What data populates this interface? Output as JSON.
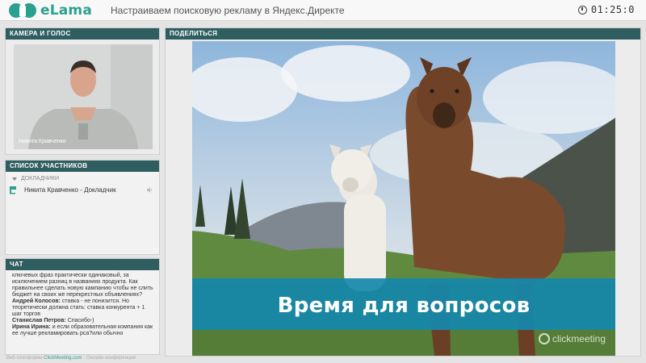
{
  "header": {
    "logo_text": "eLama",
    "meeting_title": "Настраиваем поисковую рекламу в Яндекс.Директе",
    "timer": "01:25:0"
  },
  "camera": {
    "title": "КАМЕРА И ГОЛОС",
    "presenter_name": "Никита Кравченко"
  },
  "participants": {
    "title": "СПИСОК УЧАСТНИКОВ",
    "role_label": "ДОКЛАДЧИКИ",
    "items": [
      {
        "name": "Никита Кравченко - Докладчик"
      }
    ]
  },
  "chat": {
    "title": "ЧАТ",
    "messages": [
      {
        "author": "",
        "text": "ключевых фраз практически одинаковый, за исключением разниц в названиях продукта. Как правильнее сделать новую кампанию чтобы не слить бюджет на своих же перекрестных объявлениях?"
      },
      {
        "author": "Андрей Колосов:",
        "text": " ставка - не понизится. Но теоретически должна стать: ставка конкурента + 1 шаг торгов"
      },
      {
        "author": "Станислав Петров:",
        "text": " Спасибо-)"
      },
      {
        "author": "Ирина Ирина:",
        "text": " и если образовательная компания как ее лучше рекламировать рса?или обычно"
      }
    ]
  },
  "footer": {
    "prefix": "Веб-платформа",
    "link": "ClickMeeting.com",
    "suffix": "· Онлайн-конференции"
  },
  "share": {
    "title": "ПОДЕЛИТЬСЯ",
    "slide_caption": "Время для вопросов",
    "watermark": "clickmeeting"
  },
  "colors": {
    "panel_header": "#2f5e60",
    "brand": "#2aa08e",
    "banner": "#1688ab"
  }
}
